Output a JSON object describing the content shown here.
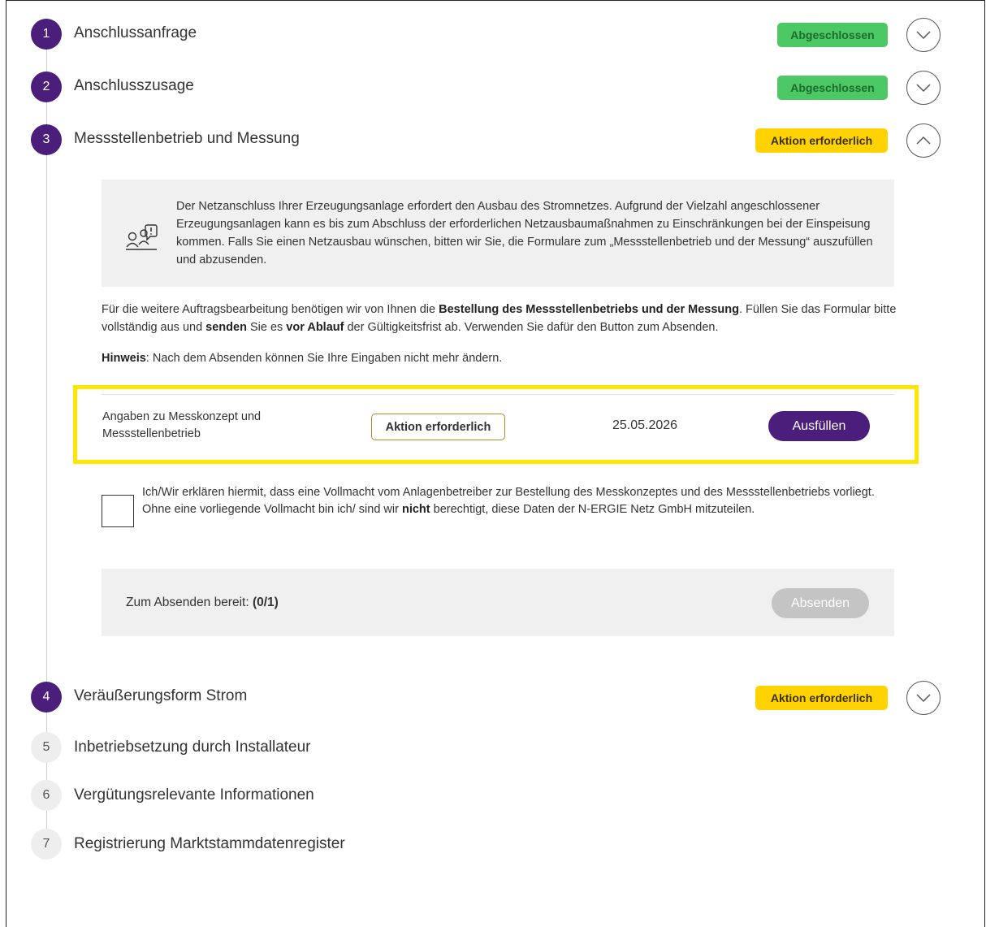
{
  "steps": [
    {
      "number": "1",
      "title": "Anschlussanfrage",
      "status": "Abgeschlossen"
    },
    {
      "number": "2",
      "title": "Anschlusszusage",
      "status": "Abgeschlossen"
    },
    {
      "number": "3",
      "title": "Messstellenbetrieb und Messung",
      "status": "Aktion erforderlich"
    },
    {
      "number": "4",
      "title": "Veräußerungsform Strom",
      "status": "Aktion erforderlich"
    },
    {
      "number": "5",
      "title": "Inbetriebsetzung durch Installateur"
    },
    {
      "number": "6",
      "title": "Vergütungsrelevante Informationen"
    },
    {
      "number": "7",
      "title": "Registrierung Marktstammdatenregister"
    }
  ],
  "info": {
    "icon": "grid-expansion-icon",
    "text": "Der Netzanschluss Ihrer Erzeugungsanlage erfordert den Ausbau des Stromnetzes. Aufgrund der Vielzahl angeschlossener Erzeugungsanlagen kann es bis zum Abschluss der erforderlichen Netzausbaumaßnahmen zu Einschränkungen bei der Einspeisung kommen. Falls Sie einen Netzausbau wünschen, bitten wir Sie, die Formulare zum „Messstellenbetrieb und der Messung“ auszufüllen und abzusenden."
  },
  "instructions": {
    "p1_a": "Für die weitere Auftragsbearbeitung benötigen wir von Ihnen die ",
    "p1_b": "Bestellung des Messstellenbetriebs und der Messung",
    "p1_c": ". Füllen Sie das Formular bitte vollständig aus und ",
    "p1_d": "senden",
    "p1_e": " Sie es ",
    "p1_f": "vor Ablauf",
    "p1_g": " der Gültigkeitsfrist ab. Verwenden Sie dafür den Button zum Absenden.",
    "hint_label": "Hinweis",
    "hint_text": ": Nach dem Absenden können Sie Ihre Eingaben nicht mehr ändern."
  },
  "form_row": {
    "label": "Angaben zu Messkonzept und Messstellenbetrieb",
    "status": "Aktion erforderlich",
    "date": "25.05.2026",
    "button": "Ausfüllen"
  },
  "consent": {
    "text_a": "Ich/Wir erklären hiermit, dass eine Vollmacht vom Anlagenbetreiber zur Bestellung des Messkonzeptes und des Messstellenbetriebs vorliegt. Ohne eine vorliegende Vollmacht bin ich/ sind wir ",
    "text_b": "nicht",
    "text_c": " berechtigt, diese Daten der N-ERGIE Netz GmbH mitzuteilen."
  },
  "submit": {
    "label": "Zum Absenden bereit: ",
    "count": "(0/1)",
    "button": "Absenden"
  },
  "colors": {
    "accent": "#4a1e7a",
    "done": "#4cc864",
    "action": "#ffd200",
    "highlight": "#ffe600"
  }
}
